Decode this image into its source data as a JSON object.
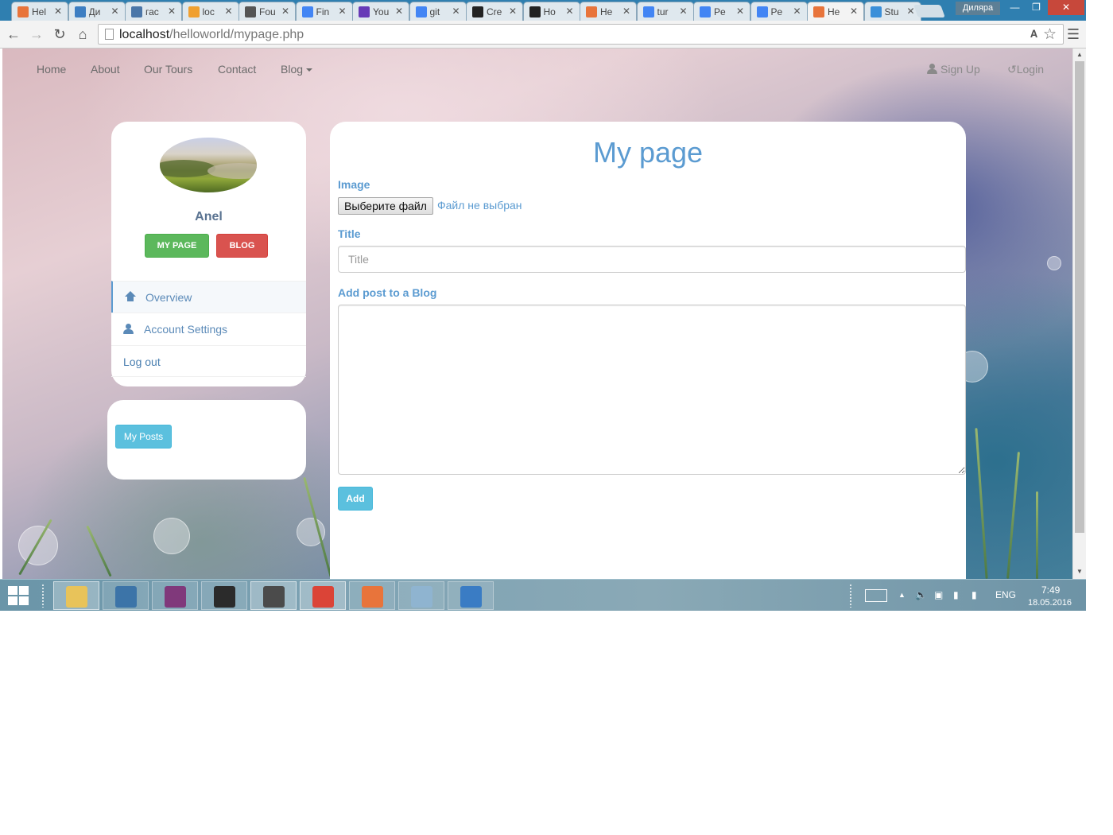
{
  "browser": {
    "tabs": [
      {
        "label": "Hel",
        "icon": "xampp-icon",
        "color": "#e8743b"
      },
      {
        "label": "Ди",
        "icon": "chat-icon",
        "color": "#3d7ec2"
      },
      {
        "label": "гас",
        "icon": "vk-icon",
        "color": "#4a76a8"
      },
      {
        "label": "loc",
        "icon": "phpmyadmin-icon",
        "color": "#f0a030"
      },
      {
        "label": "Fou",
        "icon": "contact-icon",
        "color": "#555555"
      },
      {
        "label": "Fin",
        "icon": "docs-icon",
        "color": "#4285f4"
      },
      {
        "label": "You",
        "icon": "forms-icon",
        "color": "#673ab7"
      },
      {
        "label": "git",
        "icon": "google-icon",
        "color": "#4285f4"
      },
      {
        "label": "Cre",
        "icon": "github-icon",
        "color": "#222222"
      },
      {
        "label": "Ho",
        "icon": "github-icon",
        "color": "#222222"
      },
      {
        "label": "He",
        "icon": "xampp-icon",
        "color": "#e8743b"
      },
      {
        "label": "tur",
        "icon": "google-icon",
        "color": "#4285f4"
      },
      {
        "label": "Pe",
        "icon": "google-icon",
        "color": "#4285f4"
      },
      {
        "label": "Pe",
        "icon": "google-icon",
        "color": "#4285f4"
      },
      {
        "label": "He",
        "icon": "xampp-icon",
        "color": "#e8743b"
      },
      {
        "label": "Stu",
        "icon": "site-icon",
        "color": "#3a8fd9"
      }
    ],
    "active_tab_index": 14,
    "window_user": "Диляра",
    "address": {
      "host": "localhost",
      "path": "/helloworld/mypage.php"
    }
  },
  "site_nav": {
    "links": [
      "Home",
      "About",
      "Our Tours",
      "Contact",
      "Blog"
    ],
    "signup": "Sign Up",
    "login": "Login"
  },
  "profile": {
    "name": "Anel",
    "mypage_button": "MY PAGE",
    "blog_button": "BLOG",
    "menu": {
      "overview": "Overview",
      "account_settings": "Account Settings",
      "logout": "Log out"
    },
    "posts_button": "My Posts"
  },
  "form": {
    "heading": "My page",
    "image_label": "Image",
    "file_button": "Выберите файл",
    "file_status": "Файл не выбран",
    "title_label": "Title",
    "title_placeholder": "Title",
    "title_value": "",
    "post_label": "Add post to a Blog",
    "post_value": "",
    "add_button": "Add"
  },
  "taskbar": {
    "apps": [
      {
        "name": "file-explorer-icon",
        "color": "#e8c35a",
        "running": true
      },
      {
        "name": "python-icon",
        "color": "#3c74a8",
        "running": false
      },
      {
        "name": "onenote-icon",
        "color": "#80397b",
        "running": false
      },
      {
        "name": "terminal-icon",
        "color": "#2b2b2b",
        "running": false
      },
      {
        "name": "sublime-text-icon",
        "color": "#4b4b4b",
        "running": true
      },
      {
        "name": "chrome-icon",
        "color": "#db4437",
        "running": true
      },
      {
        "name": "xampp-icon",
        "color": "#e8743b",
        "running": false
      },
      {
        "name": "paint-icon",
        "color": "#8fb4d0",
        "running": false
      },
      {
        "name": "photos-icon",
        "color": "#3a7cc4",
        "running": false
      }
    ],
    "language": "ENG",
    "time": "7:49",
    "date": "18.05.2016"
  },
  "colors": {
    "accent": "#5b9bd1",
    "success": "#5cb85c",
    "danger": "#d9534f",
    "info": "#5bc0de"
  }
}
